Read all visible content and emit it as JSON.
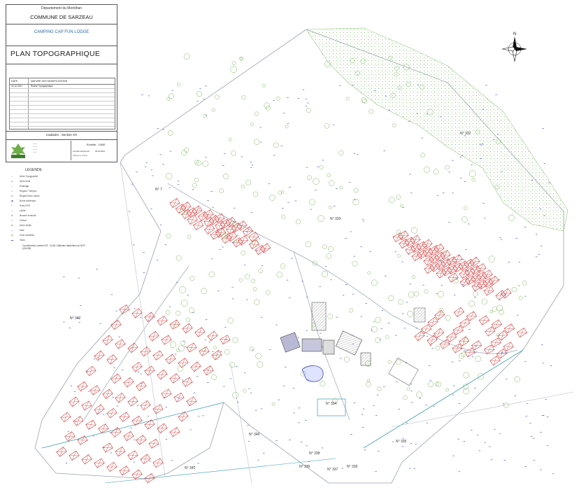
{
  "title_block": {
    "department": "Département du Morbihan",
    "commune": "COMMUNE DE SARZEAU",
    "camping": "CAMPING CAP FUN LODGE",
    "plan_title": "PLAN TOPOGRAPHIQUE",
    "table_header_date": "DATE",
    "table_header_nature": "NATURE DES MODIFICATIONS",
    "table_first_date": "04.10.2021",
    "table_first_nature": "Relevé Topographique",
    "cadastre": "Cadastre : Section XX",
    "scale": "Echelle : 1/500",
    "format_label": "Format imprimé A0",
    "format_date": "04.10.2021",
    "reference": "Référence dossier"
  },
  "legend": {
    "title": "LEGENDE",
    "items": [
      "Arbre Topographié",
      "Arbre isolé",
      "Eclairage",
      "Regard / Tampon",
      "Regard Eaux Usées",
      "Borne électrique",
      "Point GPS",
      "Limite",
      "Bouche incendie",
      "Clôture",
      "Arbre feuillu",
      "Haie",
      "Zone arbustive",
      "Talus"
    ],
    "note": "Coordonnées Lambert 93 - CC48 / Altitudes rattachées au NGF (IGN 69)"
  },
  "parcels": [
    "N° 332",
    "N° 7",
    "N° 333",
    "N° 342",
    "N° 334",
    "N° 340",
    "N° 335",
    "N° 338",
    "N° 336",
    "N° 337",
    "N° 339",
    "N° 341"
  ],
  "compass": {
    "north_label": "N"
  },
  "colors": {
    "plot_outline": "#d23a3a",
    "vegetation": "#7ab55c",
    "wood_hatch": "#9ac78c",
    "lines": "#7d8ea0",
    "survey_points": "#4a5fc1"
  }
}
